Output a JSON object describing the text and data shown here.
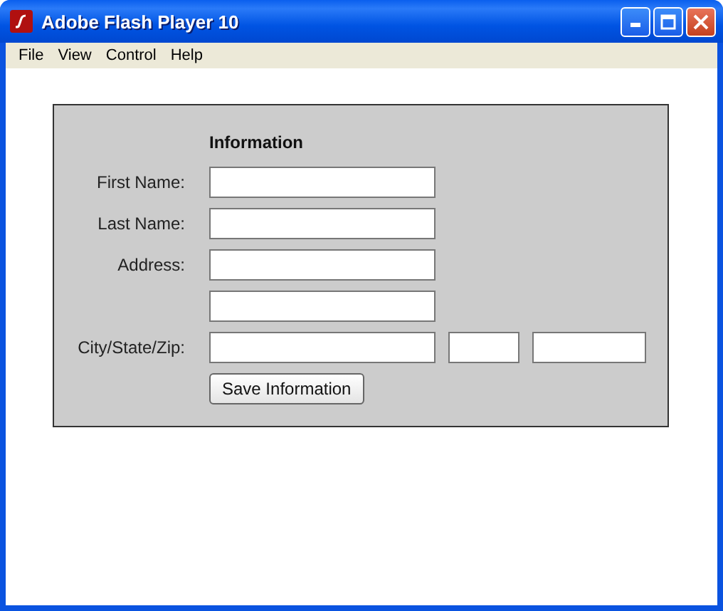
{
  "window": {
    "title": "Adobe Flash Player 10"
  },
  "menu": [
    "File",
    "View",
    "Control",
    "Help"
  ],
  "form": {
    "heading": "Information",
    "rows": [
      {
        "label": "First Name:",
        "fields": [
          {
            "kind": "wide"
          }
        ]
      },
      {
        "label": "Last Name:",
        "fields": [
          {
            "kind": "wide"
          }
        ]
      },
      {
        "label": "Address:",
        "fields": [
          {
            "kind": "wide"
          }
        ]
      },
      {
        "fields": [
          {
            "kind": "wide"
          }
        ]
      },
      {
        "label": "City/State/Zip:",
        "fields": [
          {
            "kind": "wide"
          },
          {
            "kind": "short"
          },
          {
            "kind": "medium"
          }
        ]
      }
    ],
    "button": "Save Information"
  }
}
